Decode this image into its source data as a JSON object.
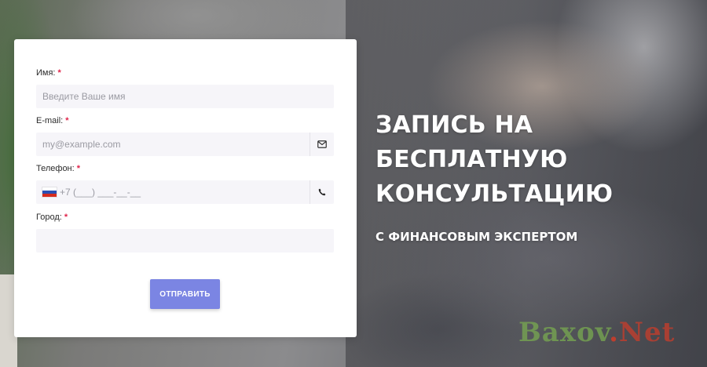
{
  "form": {
    "name": {
      "label": "Имя:",
      "required": "*",
      "placeholder": "Введите Ваше имя",
      "value": ""
    },
    "email": {
      "label": "E-mail:",
      "required": "*",
      "placeholder": "my@example.com",
      "value": "",
      "icon": "envelope-icon"
    },
    "phone": {
      "label": "Телефон:",
      "required": "*",
      "placeholder": "+7 (___) ___-__-__",
      "value": "",
      "flag_icon": "russia-flag-icon",
      "icon": "phone-icon"
    },
    "city": {
      "label": "Город:",
      "required": "*",
      "placeholder": "",
      "value": ""
    },
    "submit_label": "ОТПРАВИТЬ"
  },
  "promo": {
    "headline_lines": [
      "ЗАПИСЬ НА",
      "БЕСПЛАТНУЮ",
      "КОНСУЛЬТАЦИЮ"
    ],
    "subheadline": "С ФИНАНСОВЫМ ЭКСПЕРТОМ"
  },
  "watermark": {
    "part1": "Baxov",
    "dot": ".",
    "part2": "Net"
  },
  "colors": {
    "accent": "#7b85e3",
    "required": "#e0244a",
    "input_bg": "#f6f5f9"
  }
}
